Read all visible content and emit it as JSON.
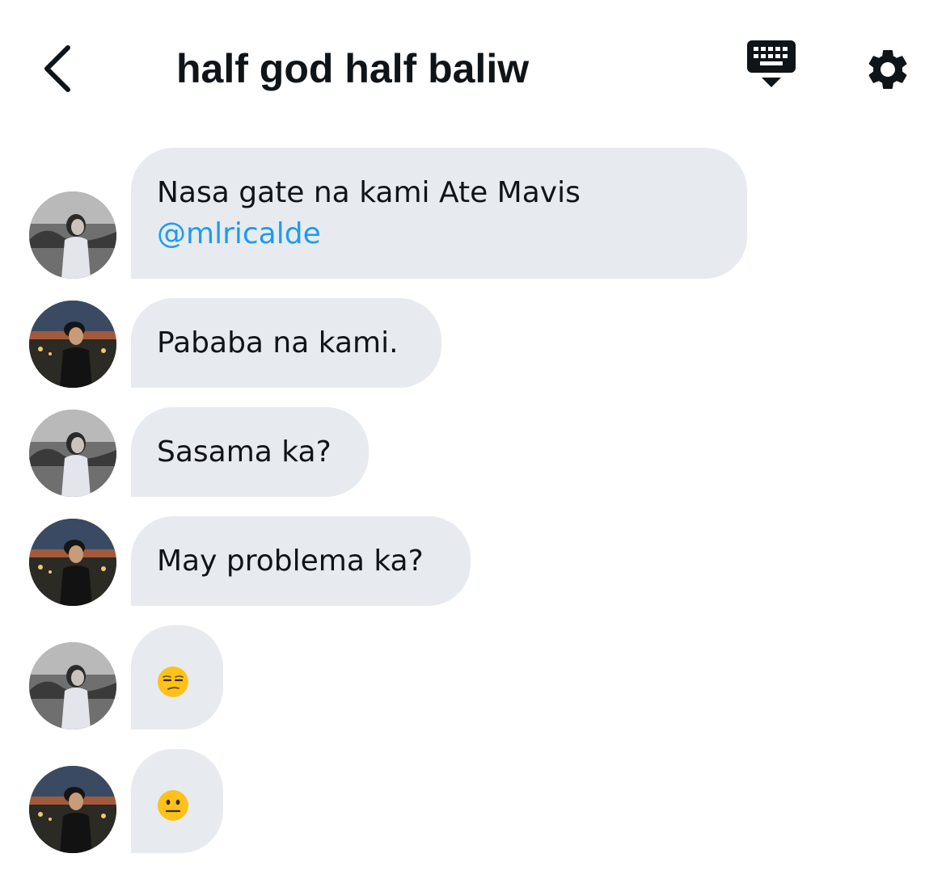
{
  "header": {
    "title": "half god half baliw",
    "back_icon": "chevron-left-icon",
    "keyboard_icon": "keyboard-icon",
    "settings_icon": "gear-icon"
  },
  "colors": {
    "bubble": "#e7ebef",
    "text": "#0f1419",
    "mention": "#1d9bf0"
  },
  "messages": [
    {
      "sender": "user-a",
      "text": "Nasa gate na kami Ate Mavis",
      "mention": "@mlricalde"
    },
    {
      "sender": "user-b",
      "text": "Pababa na kami."
    },
    {
      "sender": "user-a",
      "text": "Sasama ka?"
    },
    {
      "sender": "user-b",
      "text": "May problema ka?"
    },
    {
      "sender": "user-a",
      "emoji": "unamused-face-emoji"
    },
    {
      "sender": "user-b",
      "emoji": "neutral-face-emoji"
    }
  ]
}
